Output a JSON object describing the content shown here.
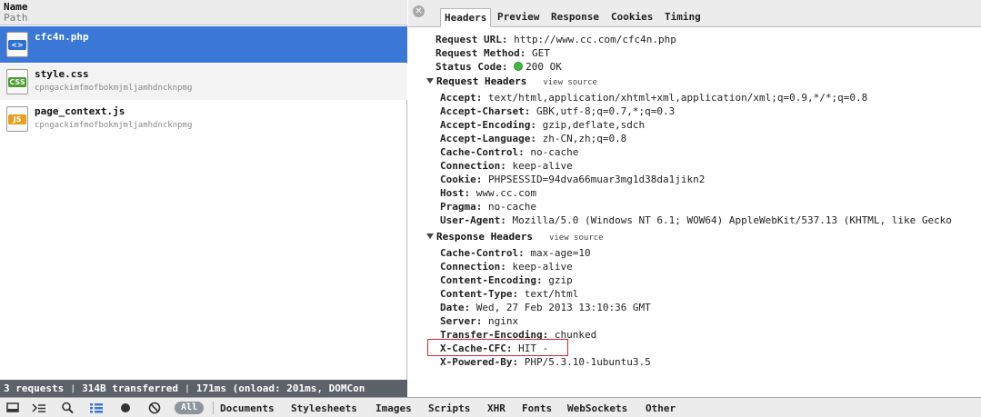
{
  "columns": {
    "name": "Name",
    "path": "Path"
  },
  "requests": [
    {
      "name": "cfc4n.php",
      "path": "",
      "icon": "html-file-icon",
      "tag": "<>",
      "tag_color": "#2f6fcf",
      "selected": true
    },
    {
      "name": "style.css",
      "path": "cpngackimfmofbokmjmljamhdncknpmg",
      "icon": "css-file-icon",
      "tag": "CSS",
      "tag_color": "#4a9c2e",
      "selected": false
    },
    {
      "name": "page_context.js",
      "path": "cpngackimfmofbokmjmljamhdncknpmg",
      "icon": "js-file-icon",
      "tag": "JS",
      "tag_color": "#e7a11c",
      "selected": false
    }
  ],
  "status_bar": "3 requests  ❘  314B transferred  ❘  171ms (onload: 201ms, DOMCon",
  "tabs": [
    {
      "label": "Headers",
      "active": true
    },
    {
      "label": "Preview",
      "active": false
    },
    {
      "label": "Response",
      "active": false
    },
    {
      "label": "Cookies",
      "active": false
    },
    {
      "label": "Timing",
      "active": false
    }
  ],
  "general": {
    "request_url_key": "Request URL:",
    "request_url": "http://www.cc.com/cfc4n.php",
    "request_method_key": "Request Method:",
    "request_method": "GET",
    "status_code_key": "Status Code:",
    "status_code": "200 OK"
  },
  "request_headers": {
    "title": "Request Headers",
    "view_source": "view source",
    "items": [
      {
        "key": "Accept:",
        "value": "text/html,application/xhtml+xml,application/xml;q=0.9,*/*;q=0.8"
      },
      {
        "key": "Accept-Charset:",
        "value": "GBK,utf-8;q=0.7,*;q=0.3"
      },
      {
        "key": "Accept-Encoding:",
        "value": "gzip,deflate,sdch"
      },
      {
        "key": "Accept-Language:",
        "value": "zh-CN,zh;q=0.8"
      },
      {
        "key": "Cache-Control:",
        "value": "no-cache"
      },
      {
        "key": "Connection:",
        "value": "keep-alive"
      },
      {
        "key": "Cookie:",
        "value": "PHPSESSID=94dva66muar3mg1d38da1jikn2"
      },
      {
        "key": "Host:",
        "value": "www.cc.com"
      },
      {
        "key": "Pragma:",
        "value": "no-cache"
      },
      {
        "key": "User-Agent:",
        "value": "Mozilla/5.0 (Windows NT 6.1; WOW64) AppleWebKit/537.13 (KHTML, like Gecko"
      }
    ]
  },
  "response_headers": {
    "title": "Response Headers",
    "view_source": "view source",
    "items": [
      {
        "key": "Cache-Control:",
        "value": "max-age=10"
      },
      {
        "key": "Connection:",
        "value": "keep-alive"
      },
      {
        "key": "Content-Encoding:",
        "value": "gzip"
      },
      {
        "key": "Content-Type:",
        "value": "text/html"
      },
      {
        "key": "Date:",
        "value": "Wed, 27 Feb 2013 13:10:36 GMT"
      },
      {
        "key": "Server:",
        "value": "nginx"
      },
      {
        "key": "Transfer-Encoding:",
        "value": "chunked"
      },
      {
        "key": "X-Cache-CFC:",
        "value": "HIT -"
      },
      {
        "key": "X-Powered-By:",
        "value": "PHP/5.3.10-1ubuntu3.5"
      }
    ]
  },
  "toolbar": {
    "all_label": "All",
    "filters": [
      "Documents",
      "Stylesheets",
      "Images",
      "Scripts",
      "XHR",
      "Fonts",
      "WebSockets",
      "Other"
    ]
  },
  "colors": {
    "selected_row": "#3b77d6",
    "status_bg": "#5d6169",
    "highlight_box": "#d6262c",
    "status_ok": "#3fb93f"
  }
}
